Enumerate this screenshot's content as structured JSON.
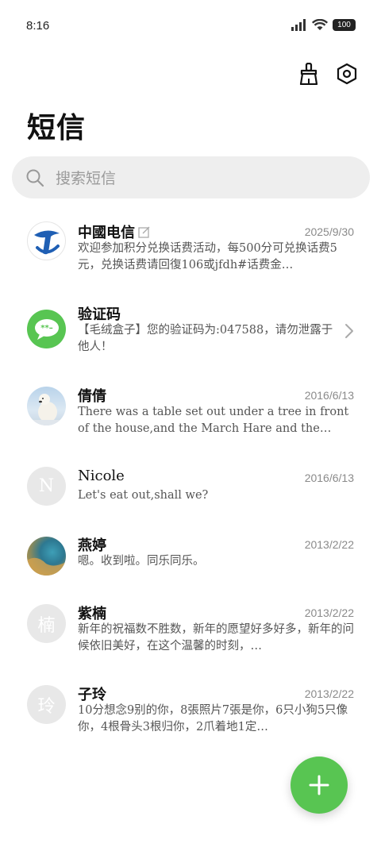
{
  "status_bar": {
    "time": "8:16",
    "battery": "100"
  },
  "header": {
    "title": "短信"
  },
  "search": {
    "placeholder": "搜索短信"
  },
  "messages": [
    {
      "name": "中國电信",
      "date": "2025/9/30",
      "preview": "欢迎参加积分兑换话费活动，每500分可兑换话费5元，兑换话费请回復106或jfdh#话费金…",
      "avatar": "china-telecom-logo"
    },
    {
      "name": "验证码",
      "date": "",
      "preview": "【毛绒盒子】您的验证码为:047588，请勿泄露于他人！",
      "avatar": "sms-bubble-icon"
    },
    {
      "name": "倩倩",
      "date": "2016/6/13",
      "preview": "There was a table set out under a tree in front of the house,and the March Hare and the Hat…",
      "avatar": "polar-bear-photo"
    },
    {
      "name": "Nicole",
      "date": "2016/6/13",
      "preview": "Let's eat out,shall we?",
      "avatar_letter": "N"
    },
    {
      "name": "燕婷",
      "date": "2013/2/22",
      "preview": "嗯。收到啦。同乐同乐。",
      "avatar": "landscape-photo"
    },
    {
      "name": "紫楠",
      "date": "2013/2/22",
      "preview": "新年的祝福数不胜数，新年的愿望好多好多，新年的问候依旧美好，在这个温馨的时刻，…",
      "avatar_letter": "楠"
    },
    {
      "name": "子玲",
      "date": "2013/2/22",
      "preview": "10分想念9别的你，8張照片7張是你，6只小狗5只像你，4根骨头3根归你，2爪着地1定…",
      "avatar_letter": "玲"
    }
  ],
  "colors": {
    "accent": "#58c552",
    "telecom_blue": "#1f5fb4",
    "fab": "#58c552"
  }
}
